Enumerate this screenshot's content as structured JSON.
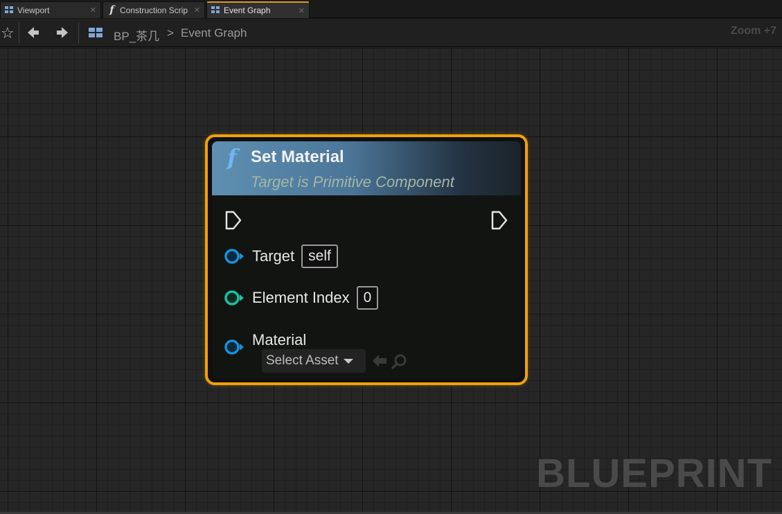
{
  "tabs": [
    {
      "label": "Viewport",
      "icon": "viewport-icon"
    },
    {
      "label": "Construction Scrip",
      "icon": "function-icon"
    },
    {
      "label": "Event Graph",
      "icon": "event-graph-icon",
      "active": true
    }
  ],
  "toolbar": {
    "breadcrumb_root": "BP_茶几",
    "breadcrumb_separator": ">",
    "breadcrumb_current": "Event Graph",
    "zoom": "Zoom +7"
  },
  "node": {
    "title": "Set Material",
    "subtitle": "Target is Primitive Component",
    "pins": {
      "target": {
        "label": "Target",
        "value": "self"
      },
      "element_index": {
        "label": "Element Index",
        "value": "0"
      },
      "material": {
        "label": "Material",
        "select_label": "Select Asset"
      }
    }
  },
  "watermark": "BLUEPRINT",
  "colors": {
    "node_border": "#f0a10b",
    "object_pin": "#1c8fd6",
    "integer_pin": "#1fbf9e",
    "header": "#5e8fb1"
  }
}
